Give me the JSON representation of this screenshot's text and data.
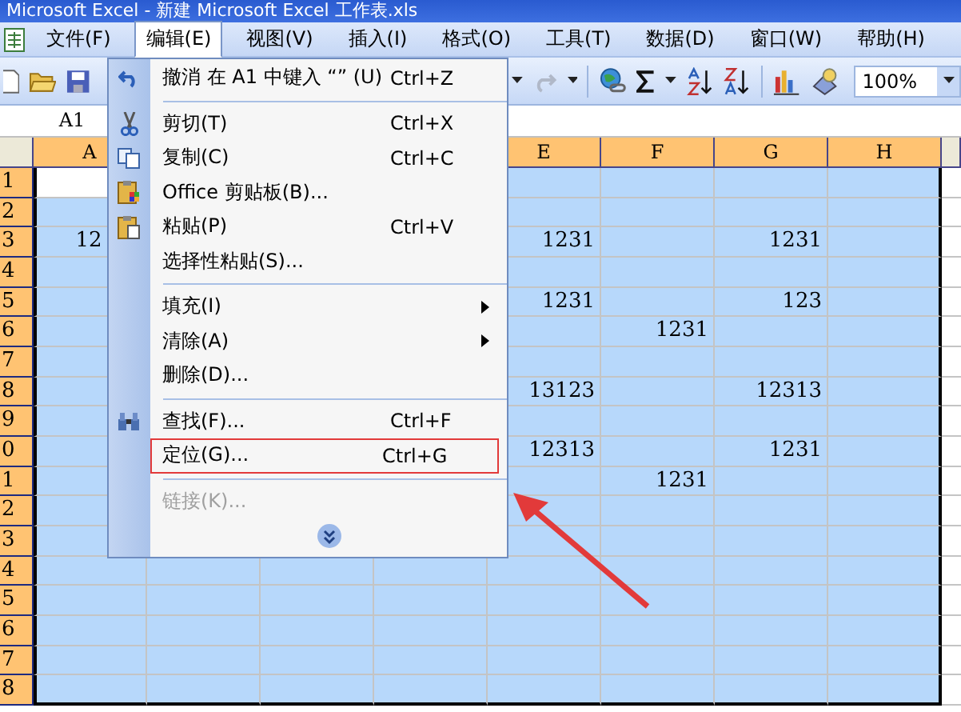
{
  "title_bar": {
    "title": "Microsoft Excel - 新建 Microsoft Excel 工作表.xls"
  },
  "menu_bar": [
    {
      "label": "文件(F)",
      "selected": false
    },
    {
      "label": "编辑(E)",
      "selected": true
    },
    {
      "label": "视图(V)",
      "selected": false
    },
    {
      "label": "插入(I)",
      "selected": false
    },
    {
      "label": "格式(O)",
      "selected": false
    },
    {
      "label": "工具(T)",
      "selected": false
    },
    {
      "label": "数据(D)",
      "selected": false
    },
    {
      "label": "窗口(W)",
      "selected": false
    },
    {
      "label": "帮助(H)",
      "selected": false
    }
  ],
  "toolbar": {
    "zoom": "100%"
  },
  "name_box": {
    "value": "A1"
  },
  "column_headers_left": [
    {
      "label": "A",
      "selected": true
    }
  ],
  "column_headers_right": [
    {
      "label": "E",
      "selected": true
    },
    {
      "label": "F",
      "selected": true
    },
    {
      "label": "G",
      "selected": true
    },
    {
      "label": "H",
      "selected": true
    }
  ],
  "rows": [
    {
      "label": "1",
      "selected": true,
      "cells": [
        {
          "selected": false
        },
        null,
        null,
        null,
        {
          "selected": true
        },
        {
          "selected": true
        },
        {
          "selected": true
        },
        {
          "selected": true
        }
      ]
    },
    {
      "label": "2",
      "selected": true,
      "cells": [
        {
          "selected": true
        },
        null,
        null,
        null,
        {
          "selected": true
        },
        {
          "selected": true
        },
        {
          "selected": true
        },
        {
          "selected": true
        }
      ]
    },
    {
      "label": "3",
      "selected": true,
      "cells": [
        {
          "value": "12",
          "selected": true
        },
        null,
        null,
        null,
        {
          "value": "1231",
          "selected": true
        },
        {
          "selected": true
        },
        {
          "value": "1231",
          "selected": true
        },
        {
          "selected": true
        }
      ]
    },
    {
      "label": "4",
      "selected": true,
      "cells": [
        {
          "selected": true
        },
        null,
        null,
        null,
        {
          "selected": true
        },
        {
          "selected": true
        },
        {
          "selected": true
        },
        {
          "selected": true
        }
      ]
    },
    {
      "label": "5",
      "selected": true,
      "cells": [
        {
          "selected": true
        },
        null,
        null,
        null,
        {
          "value": "1231",
          "selected": true
        },
        {
          "selected": true
        },
        {
          "value": "123",
          "selected": true
        },
        {
          "selected": true
        }
      ]
    },
    {
      "label": "6",
      "selected": true,
      "cells": [
        {
          "selected": true
        },
        null,
        null,
        null,
        {
          "selected": true
        },
        {
          "value": "1231",
          "selected": true
        },
        {
          "selected": true
        },
        {
          "selected": true
        }
      ]
    },
    {
      "label": "7",
      "selected": true,
      "cells": [
        {
          "selected": true
        },
        null,
        null,
        null,
        {
          "selected": true
        },
        {
          "selected": true
        },
        {
          "selected": true
        },
        {
          "selected": true
        }
      ]
    },
    {
      "label": "8",
      "selected": true,
      "cells": [
        {
          "selected": true
        },
        null,
        null,
        null,
        {
          "value": "13123",
          "selected": true
        },
        {
          "selected": true
        },
        {
          "value": "12313",
          "selected": true
        },
        {
          "selected": true
        }
      ]
    },
    {
      "label": "9",
      "selected": true,
      "cells": [
        {
          "selected": true
        },
        null,
        null,
        null,
        {
          "selected": true
        },
        {
          "selected": true
        },
        {
          "selected": true
        },
        {
          "selected": true
        }
      ]
    },
    {
      "label": "0",
      "selected": true,
      "cells": [
        {
          "selected": true
        },
        null,
        null,
        null,
        {
          "value": "12313",
          "selected": true
        },
        {
          "selected": true
        },
        {
          "value": "1231",
          "selected": true
        },
        {
          "selected": true
        }
      ]
    },
    {
      "label": "1",
      "selected": true,
      "cells": [
        {
          "selected": true
        },
        null,
        null,
        null,
        {
          "selected": true
        },
        {
          "value": "1231",
          "selected": true
        },
        {
          "selected": true
        },
        {
          "selected": true
        }
      ]
    },
    {
      "label": "2",
      "selected": true,
      "cells": [
        {
          "selected": true
        },
        null,
        null,
        null,
        {
          "selected": true
        },
        {
          "selected": true
        },
        {
          "selected": true
        },
        {
          "selected": true
        }
      ]
    },
    {
      "label": "3",
      "selected": true,
      "cells": [
        {
          "selected": true
        },
        null,
        null,
        null,
        {
          "selected": true
        },
        {
          "selected": true
        },
        {
          "selected": true
        },
        {
          "selected": true
        }
      ]
    },
    {
      "label": "4",
      "selected": true,
      "cells": [
        {
          "selected": true
        },
        {
          "selected": true
        },
        {
          "selected": true
        },
        {
          "selected": true
        },
        {
          "selected": true
        },
        {
          "selected": true
        },
        {
          "selected": true
        },
        {
          "selected": true
        }
      ]
    },
    {
      "label": "5",
      "selected": true,
      "cells": [
        {
          "selected": true
        },
        {
          "selected": true
        },
        {
          "selected": true
        },
        {
          "selected": true
        },
        {
          "selected": true
        },
        {
          "selected": true
        },
        {
          "selected": true
        },
        {
          "selected": true
        }
      ]
    },
    {
      "label": "6",
      "selected": true,
      "cells": [
        {
          "selected": true
        },
        {
          "selected": true
        },
        {
          "selected": true
        },
        {
          "selected": true
        },
        {
          "selected": true
        },
        {
          "selected": true
        },
        {
          "selected": true
        },
        {
          "selected": true
        }
      ]
    },
    {
      "label": "7",
      "selected": true,
      "cells": [
        {
          "selected": true
        },
        {
          "selected": true
        },
        {
          "selected": true
        },
        {
          "selected": true
        },
        {
          "selected": true
        },
        {
          "selected": true
        },
        {
          "selected": true
        },
        {
          "selected": true
        }
      ]
    },
    {
      "label": "8",
      "selected": true,
      "cells": [
        {
          "selected": true
        },
        {
          "selected": true
        },
        {
          "selected": true
        },
        {
          "selected": true
        },
        {
          "selected": true
        },
        {
          "selected": true
        },
        {
          "selected": true
        },
        {
          "selected": true
        }
      ]
    }
  ],
  "edit_menu": [
    {
      "kind": "item",
      "label": "撤消 在 A1 中键入 “”  (U)",
      "shortcut": "Ctrl+Z",
      "submenu": false,
      "disabled": false,
      "outlined": false
    },
    {
      "kind": "separator"
    },
    {
      "kind": "item",
      "label": "剪切(T)",
      "shortcut": "Ctrl+X",
      "submenu": false,
      "disabled": false,
      "outlined": false
    },
    {
      "kind": "item",
      "label": "复制(C)",
      "shortcut": "Ctrl+C",
      "submenu": false,
      "disabled": false,
      "outlined": false
    },
    {
      "kind": "item",
      "label": "Office 剪贴板(B)...",
      "submenu": false,
      "disabled": false,
      "outlined": false
    },
    {
      "kind": "item",
      "label": "粘贴(P)",
      "shortcut": "Ctrl+V",
      "submenu": false,
      "disabled": false,
      "outlined": false
    },
    {
      "kind": "item",
      "label": "选择性粘贴(S)...",
      "submenu": false,
      "disabled": false,
      "outlined": false
    },
    {
      "kind": "separator"
    },
    {
      "kind": "item",
      "label": "填充(I)",
      "submenu": true,
      "disabled": false,
      "outlined": false
    },
    {
      "kind": "item",
      "label": "清除(A)",
      "submenu": true,
      "disabled": false,
      "outlined": false
    },
    {
      "kind": "item",
      "label": "删除(D)...",
      "submenu": false,
      "disabled": false,
      "outlined": false
    },
    {
      "kind": "separator"
    },
    {
      "kind": "item",
      "label": "查找(F)...",
      "shortcut": "Ctrl+F",
      "submenu": false,
      "disabled": false,
      "outlined": false
    },
    {
      "kind": "item",
      "label": "定位(G)...",
      "shortcut": "Ctrl+G",
      "submenu": false,
      "disabled": false,
      "outlined": true
    },
    {
      "kind": "separator"
    },
    {
      "kind": "item",
      "label": "链接(K)...",
      "submenu": false,
      "disabled": true,
      "outlined": false
    },
    {
      "kind": "expand"
    }
  ]
}
